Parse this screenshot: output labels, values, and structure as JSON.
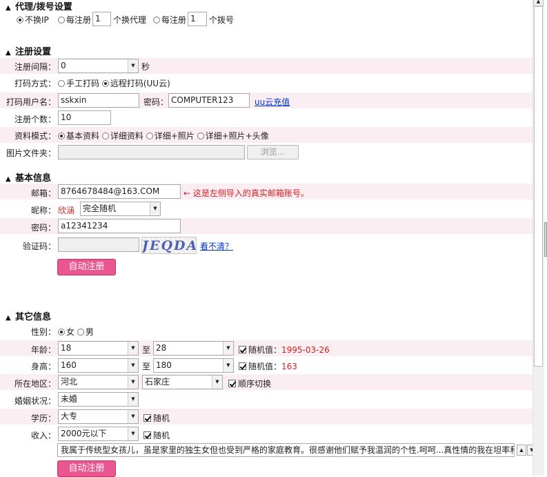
{
  "proxy": {
    "title": "代理/拨号设置",
    "opt_none": "不换IP",
    "opt_every_pre": "每注册",
    "opt_every_val": "1",
    "opt_every_post": "个换代理",
    "opt_dial_pre": "每注册",
    "opt_dial_val": "1",
    "opt_dial_post": "个拨号"
  },
  "reg": {
    "title": "注册设置",
    "interval_label": "注册间隔：",
    "interval_value": "0",
    "interval_unit": "秒",
    "captcha_mode_label": "打码方式：",
    "captcha_manual": "手工打码",
    "captcha_remote": "远程打码(UU云)",
    "captcha_user_label": "打码用户名：",
    "captcha_user": "sskxin",
    "captcha_pwd_label": "密码：",
    "captcha_pwd": "COMPUTER123",
    "recharge_link": "uu云充值",
    "count_label": "注册个数：",
    "count_value": "10",
    "profile_mode_label": "资料模式：",
    "profile_basic": "基本资料",
    "profile_detail": "详细资料",
    "profile_photo": "详细+照片",
    "profile_photo_avatar": "详细+照片+头像",
    "image_folder_label": "图片文件夹：",
    "browse_label": "浏览..."
  },
  "basic": {
    "title": "基本信息",
    "email_label": "邮箱：",
    "email_value": "8764678484@163.COM",
    "email_hint": "← 这是左侧导入的真实邮箱账号。",
    "nick_label": "昵称：",
    "nick_value": "欣涵",
    "nick_mode": "完全随机",
    "pwd_label": "密码：",
    "pwd_value": "a12341234",
    "verify_label": "验证码：",
    "captcha_image_text": "JEQDA",
    "refresh_link": "看不清？",
    "submit_label": "自动注册"
  },
  "other": {
    "title": "其它信息",
    "gender_label": "性别：",
    "gender_female": "女",
    "gender_male": "男",
    "age_label": "年龄：",
    "age_from": "18",
    "to_label": "至",
    "age_to": "28",
    "age_random_label": "随机值：",
    "age_random_value": "1995-03-26",
    "height_label": "身高：",
    "height_from": "160",
    "height_to": "180",
    "height_random_label": "随机值：",
    "height_random_value": "163",
    "region_label": "所在地区：",
    "province": "河北",
    "city": "石家庄",
    "region_cycle": "顺序切换",
    "marital_label": "婚姻状况：",
    "marital_value": "未婚",
    "edu_label": "学历：",
    "edu_value": "大专",
    "edu_random": "随机",
    "income_label": "收入：",
    "income_value": "2000元以下",
    "income_random": "随机",
    "self_intro": "我属于传统型女孩儿，虽是家里的独生女但也受到严格的家庭教育。很感谢他们赋予我温润的个性.呵呵...真性情的我在坦率和",
    "submit_label": "自动注册"
  }
}
